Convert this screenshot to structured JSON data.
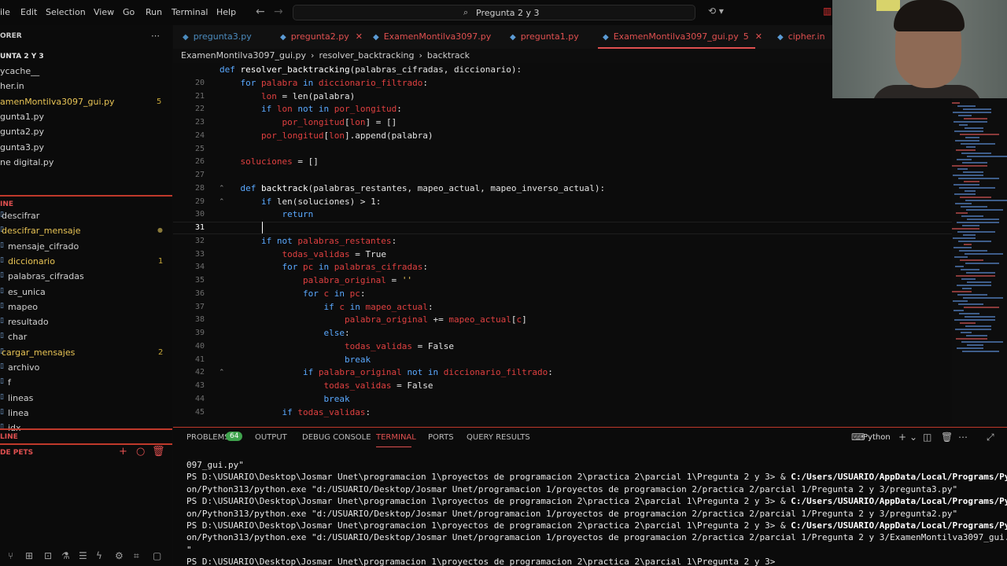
{
  "menu": [
    "ile",
    "Edit",
    "Selection",
    "View",
    "Go",
    "Run",
    "Terminal",
    "Help"
  ],
  "search": {
    "text": "Pregunta 2 y 3"
  },
  "tabs": [
    {
      "label": "pregunta3.py",
      "color": "#4b8bbe"
    },
    {
      "label": "pregunta2.py",
      "color": "#e05050",
      "close": "✕"
    },
    {
      "label": "ExamenMontilva3097.py",
      "color": "#e05050"
    },
    {
      "label": "pregunta1.py",
      "color": "#e05050"
    },
    {
      "label": "ExamenMontilva3097_gui.py",
      "color": "#e05050",
      "badge": "5",
      "close": "✕"
    },
    {
      "label": "cipher.in",
      "color": "#e05050"
    }
  ],
  "breadcrumb": [
    "ExamenMontilva3097_gui.py",
    "›",
    "resolver_backtracking",
    "›",
    "backtrack"
  ],
  "sidebar": {
    "explorer_title": "ORER",
    "folder": "UNTA 2 Y 3",
    "files": [
      {
        "label": "ycache__",
        "color": "#d0d0d0"
      },
      {
        "label": "her.in",
        "color": "#d0d0d0"
      },
      {
        "label": "amenMontilva3097_gui.py",
        "color": "#e8c455",
        "badge": "5"
      },
      {
        "label": "gunta1.py",
        "color": "#d0d0d0"
      },
      {
        "label": "gunta2.py",
        "color": "#d0d0d0"
      },
      {
        "label": "gunta3.py",
        "color": "#d0d0d0"
      },
      {
        "label": "ne digital.py",
        "color": "#d0d0d0"
      }
    ],
    "outline_title": "INE",
    "outline": [
      {
        "label": "descifrar",
        "color": "#d0d0d0",
        "indent": 2
      },
      {
        "label": "descifrar_mensaje",
        "color": "#e8c455",
        "indent": 2,
        "dot": "●"
      },
      {
        "label": "mensaje_cifrado",
        "color": "#d0d0d0",
        "indent": 10
      },
      {
        "label": "diccionario",
        "color": "#e8c455",
        "indent": 10,
        "badge": "1"
      },
      {
        "label": "palabras_cifradas",
        "color": "#d0d0d0",
        "indent": 10
      },
      {
        "label": "es_unica",
        "color": "#d0d0d0",
        "indent": 10
      },
      {
        "label": "mapeo",
        "color": "#d0d0d0",
        "indent": 10
      },
      {
        "label": "resultado",
        "color": "#d0d0d0",
        "indent": 10
      },
      {
        "label": "char",
        "color": "#d0d0d0",
        "indent": 10
      },
      {
        "label": "cargar_mensajes",
        "color": "#e8c455",
        "indent": 2,
        "badge": "2"
      },
      {
        "label": "archivo",
        "color": "#d0d0d0",
        "indent": 10
      },
      {
        "label": "f",
        "color": "#d0d0d0",
        "indent": 10
      },
      {
        "label": "lineas",
        "color": "#d0d0d0",
        "indent": 10
      },
      {
        "label": "linea",
        "color": "#d0d0d0",
        "indent": 10
      },
      {
        "label": "idx",
        "color": "#d0d0d0",
        "indent": 10
      }
    ],
    "timeline_title": "LINE",
    "pets_title": "DE PETS"
  },
  "editor": {
    "lines": [
      {
        "n": "",
        "t": [
          {
            "c": "k",
            "v": "def "
          },
          {
            "c": "f",
            "v": "resolver_backtracking"
          },
          {
            "c": "",
            "v": "(palabras_cifradas, diccionario):"
          }
        ]
      },
      {
        "n": "20",
        "t": [
          {
            "c": "",
            "v": "    "
          },
          {
            "c": "k",
            "v": "for "
          },
          {
            "c": "v",
            "v": "palabra "
          },
          {
            "c": "k",
            "v": "in "
          },
          {
            "c": "v",
            "v": "diccionario_filtrado"
          },
          {
            "c": "",
            "v": ":"
          }
        ]
      },
      {
        "n": "21",
        "t": [
          {
            "c": "",
            "v": "        "
          },
          {
            "c": "v",
            "v": "lon"
          },
          {
            "c": "",
            "v": " = len(palabra)"
          }
        ]
      },
      {
        "n": "22",
        "t": [
          {
            "c": "",
            "v": "        "
          },
          {
            "c": "k",
            "v": "if "
          },
          {
            "c": "v",
            "v": "lon "
          },
          {
            "c": "k",
            "v": "not in "
          },
          {
            "c": "v",
            "v": "por_longitud"
          },
          {
            "c": "",
            "v": ":"
          }
        ]
      },
      {
        "n": "23",
        "t": [
          {
            "c": "",
            "v": "            "
          },
          {
            "c": "v",
            "v": "por_longitud"
          },
          {
            "c": "",
            "v": "["
          },
          {
            "c": "v",
            "v": "lon"
          },
          {
            "c": "",
            "v": "] = []"
          }
        ]
      },
      {
        "n": "24",
        "t": [
          {
            "c": "",
            "v": "        "
          },
          {
            "c": "v",
            "v": "por_longitud"
          },
          {
            "c": "",
            "v": "["
          },
          {
            "c": "v",
            "v": "lon"
          },
          {
            "c": "",
            "v": "].append(palabra)"
          }
        ]
      },
      {
        "n": "25",
        "t": []
      },
      {
        "n": "26",
        "t": [
          {
            "c": "",
            "v": "    "
          },
          {
            "c": "v",
            "v": "soluciones"
          },
          {
            "c": "",
            "v": " = []"
          }
        ]
      },
      {
        "n": "27",
        "t": []
      },
      {
        "n": "28",
        "t": [
          {
            "c": "",
            "v": "    "
          },
          {
            "c": "k",
            "v": "def "
          },
          {
            "c": "f",
            "v": "backtrack"
          },
          {
            "c": "",
            "v": "(palabras_restantes, mapeo_actual, mapeo_inverso_actual):"
          }
        ]
      },
      {
        "n": "29",
        "t": [
          {
            "c": "",
            "v": "        "
          },
          {
            "c": "k",
            "v": "if "
          },
          {
            "c": "",
            "v": "len(soluciones) > 1:"
          }
        ]
      },
      {
        "n": "30",
        "t": [
          {
            "c": "",
            "v": "            "
          },
          {
            "c": "k",
            "v": "return"
          }
        ]
      },
      {
        "n": "31",
        "t": []
      },
      {
        "n": "32",
        "t": [
          {
            "c": "",
            "v": "        "
          },
          {
            "c": "k",
            "v": "if not "
          },
          {
            "c": "v",
            "v": "palabras_restantes"
          },
          {
            "c": "",
            "v": ":"
          }
        ]
      },
      {
        "n": "33",
        "t": [
          {
            "c": "",
            "v": "            "
          },
          {
            "c": "v",
            "v": "todas_validas"
          },
          {
            "c": "",
            "v": " = True"
          }
        ]
      },
      {
        "n": "34",
        "t": [
          {
            "c": "",
            "v": "            "
          },
          {
            "c": "k",
            "v": "for "
          },
          {
            "c": "v",
            "v": "pc "
          },
          {
            "c": "k",
            "v": "in "
          },
          {
            "c": "v",
            "v": "palabras_cifradas"
          },
          {
            "c": "",
            "v": ":"
          }
        ]
      },
      {
        "n": "35",
        "t": [
          {
            "c": "",
            "v": "                "
          },
          {
            "c": "v",
            "v": "palabra_original"
          },
          {
            "c": "",
            "v": " = "
          },
          {
            "c": "s",
            "v": "''"
          }
        ]
      },
      {
        "n": "36",
        "t": [
          {
            "c": "",
            "v": "                "
          },
          {
            "c": "k",
            "v": "for "
          },
          {
            "c": "v",
            "v": "c "
          },
          {
            "c": "k",
            "v": "in "
          },
          {
            "c": "v",
            "v": "pc"
          },
          {
            "c": "",
            "v": ":"
          }
        ]
      },
      {
        "n": "37",
        "t": [
          {
            "c": "",
            "v": "                    "
          },
          {
            "c": "k",
            "v": "if "
          },
          {
            "c": "v",
            "v": "c "
          },
          {
            "c": "k",
            "v": "in "
          },
          {
            "c": "v",
            "v": "mapeo_actual"
          },
          {
            "c": "",
            "v": ":"
          }
        ]
      },
      {
        "n": "38",
        "t": [
          {
            "c": "",
            "v": "                        "
          },
          {
            "c": "v",
            "v": "palabra_original"
          },
          {
            "c": "",
            "v": " += "
          },
          {
            "c": "v",
            "v": "mapeo_actual"
          },
          {
            "c": "",
            "v": "["
          },
          {
            "c": "v",
            "v": "c"
          },
          {
            "c": "",
            "v": "]"
          }
        ]
      },
      {
        "n": "39",
        "t": [
          {
            "c": "",
            "v": "                    "
          },
          {
            "c": "k",
            "v": "else"
          },
          {
            "c": "",
            "v": ":"
          }
        ]
      },
      {
        "n": "40",
        "t": [
          {
            "c": "",
            "v": "                        "
          },
          {
            "c": "v",
            "v": "todas_validas"
          },
          {
            "c": "",
            "v": " = False"
          }
        ]
      },
      {
        "n": "41",
        "t": [
          {
            "c": "",
            "v": "                        "
          },
          {
            "c": "k",
            "v": "break"
          }
        ]
      },
      {
        "n": "42",
        "t": [
          {
            "c": "",
            "v": "                "
          },
          {
            "c": "k",
            "v": "if "
          },
          {
            "c": "v",
            "v": "palabra_original "
          },
          {
            "c": "k",
            "v": "not in "
          },
          {
            "c": "v",
            "v": "diccionario_filtrado"
          },
          {
            "c": "",
            "v": ":"
          }
        ]
      },
      {
        "n": "43",
        "t": [
          {
            "c": "",
            "v": "                    "
          },
          {
            "c": "v",
            "v": "todas_validas"
          },
          {
            "c": "",
            "v": " = False"
          }
        ]
      },
      {
        "n": "44",
        "t": [
          {
            "c": "",
            "v": "                    "
          },
          {
            "c": "k",
            "v": "break"
          }
        ]
      },
      {
        "n": "45",
        "t": [
          {
            "c": "",
            "v": "            "
          },
          {
            "c": "k",
            "v": "if "
          },
          {
            "c": "v",
            "v": "todas_validas"
          },
          {
            "c": "",
            "v": ":"
          }
        ]
      }
    ]
  },
  "panel": {
    "tabs": [
      "PROBLEMS",
      "OUTPUT",
      "DEBUG CONSOLE",
      "TERMINAL",
      "PORTS",
      "QUERY RESULTS"
    ],
    "problems_count": "64",
    "shell": "Python",
    "terminal_lines": [
      {
        "a": "097_gui.py\"",
        "b": ""
      },
      {
        "a": "PS D:\\USUARIO\\Desktop\\Josmar Unet\\programacion 1\\proyectos de programacion 2\\practica 2\\parcial 1\\Pregunta 2 y 3> & ",
        "b": "C:/Users/USUARIO/AppData/Local/Programs/Pyth"
      },
      {
        "a": "on/Python313/python.exe \"d:/USUARIO/Desktop/Josmar Unet/programacion 1/proyectos de programacion 2/practica 2/parcial 1/Pregunta 2 y 3/pregunta3.py\"",
        "b": ""
      },
      {
        "a": "PS D:\\USUARIO\\Desktop\\Josmar Unet\\programacion 1\\proyectos de programacion 2\\practica 2\\parcial 1\\Pregunta 2 y 3> & ",
        "b": "C:/Users/USUARIO/AppData/Local/Programs/Pyth"
      },
      {
        "a": "on/Python313/python.exe \"d:/USUARIO/Desktop/Josmar Unet/programacion 1/proyectos de programacion 2/practica 2/parcial 1/Pregunta 2 y 3/pregunta2.py\"",
        "b": ""
      },
      {
        "a": "PS D:\\USUARIO\\Desktop\\Josmar Unet\\programacion 1\\proyectos de programacion 2\\practica 2\\parcial 1\\Pregunta 2 y 3> & ",
        "b": "C:/Users/USUARIO/AppData/Local/Programs/Pyth"
      },
      {
        "a": "on/Python313/python.exe \"d:/USUARIO/Desktop/Josmar Unet/programacion 1/proyectos de programacion 2/practica 2/parcial 1/Pregunta 2 y 3/ExamenMontilva3097_gui.py\"",
        "b": ""
      },
      {
        "a": "\"",
        "b": ""
      },
      {
        "a": "PS D:\\USUARIO\\Desktop\\Josmar Unet\\programacion 1\\proyectos de programacion 2\\practica 2\\parcial 1\\Pregunta 2 y 3> ",
        "b": ""
      }
    ]
  }
}
